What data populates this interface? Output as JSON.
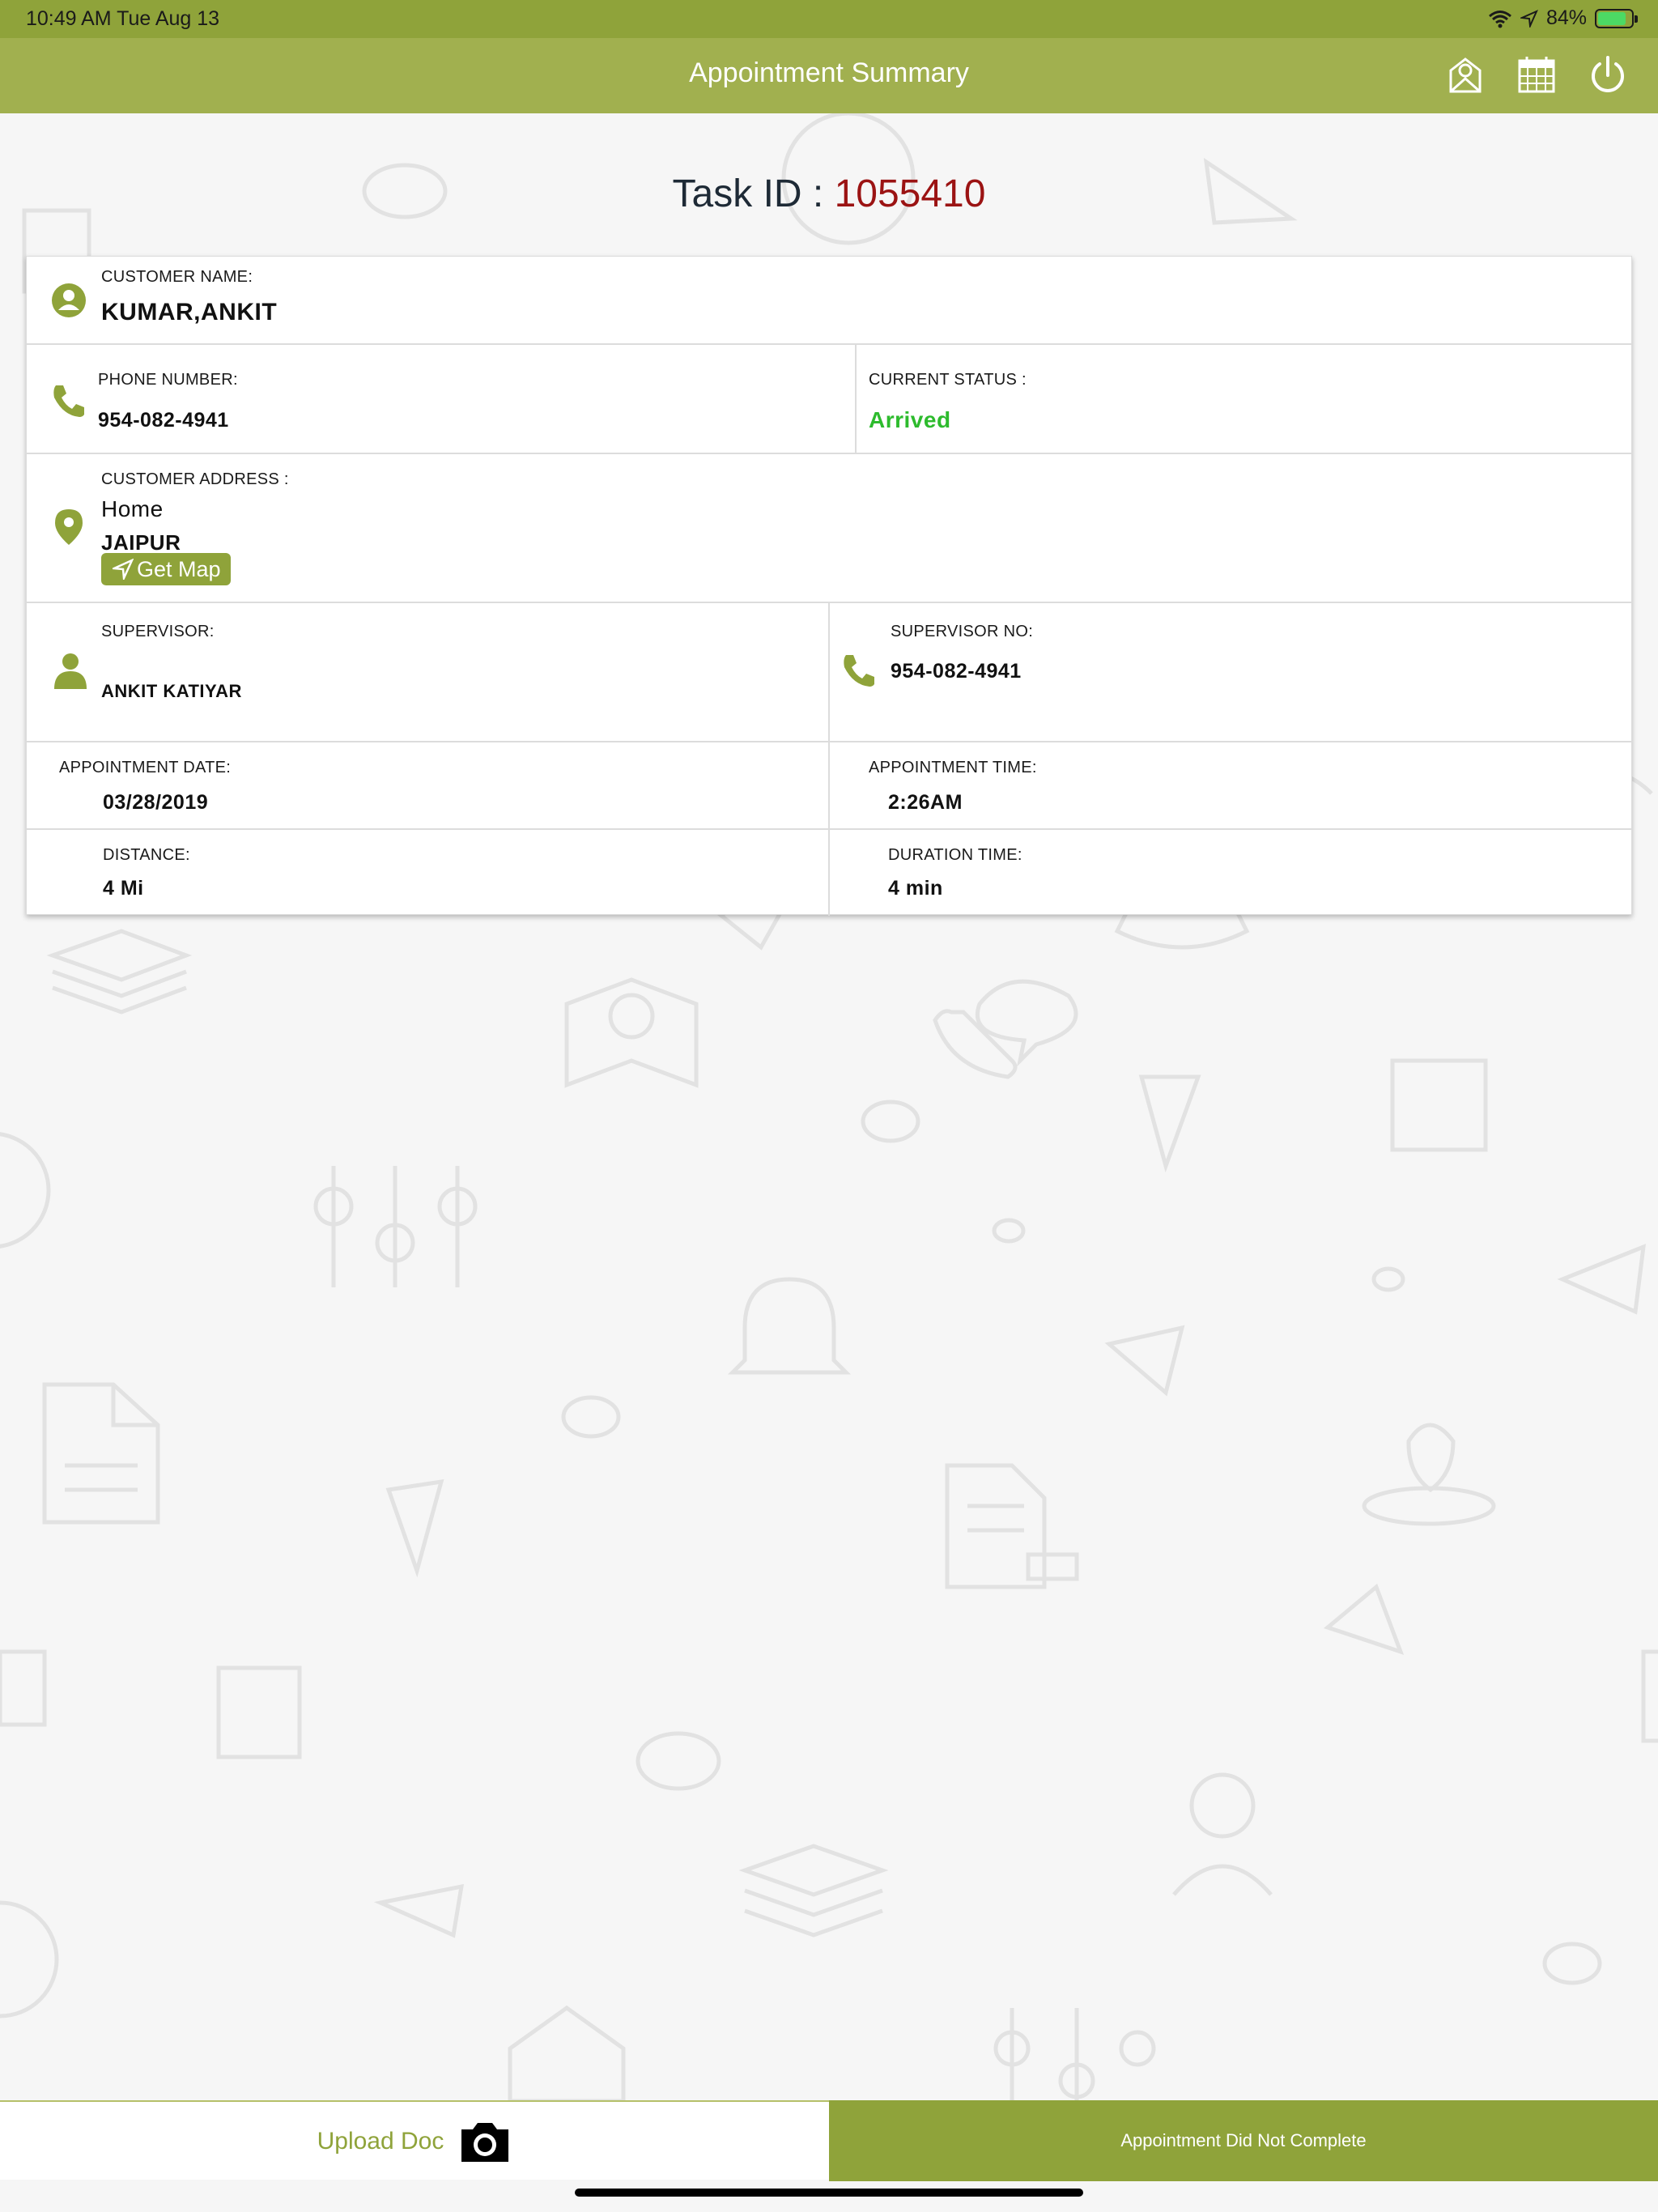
{
  "status_bar": {
    "time": "10:49 AM   Tue Aug 13",
    "battery": "84%",
    "battery_level": 0.84
  },
  "header": {
    "title": "Appointment Summary",
    "icons": [
      "mail-badge-icon",
      "calendar-icon",
      "power-icon"
    ]
  },
  "task": {
    "label": "Task ID :",
    "id": "1055410"
  },
  "customer": {
    "name_label": "CUSTOMER NAME:",
    "name": "KUMAR,ANKIT"
  },
  "phone": {
    "label": "PHONE NUMBER:",
    "value": "954-082-4941"
  },
  "status": {
    "label": "CURRENT STATUS :",
    "value": "Arrived",
    "color": "#2dbb2d"
  },
  "address": {
    "label": "CUSTOMER ADDRESS :",
    "line1": "Home",
    "city": "JAIPUR",
    "map_button": "Get Map"
  },
  "supervisor": {
    "label": "SUPERVISOR:",
    "name": "ANKIT KATIYAR",
    "no_label": "SUPERVISOR NO:",
    "no": "954-082-4941"
  },
  "appointment": {
    "date_label": "APPOINTMENT DATE:",
    "date": "03/28/2019",
    "time_label": "APPOINTMENT TIME:",
    "time": "2:26AM"
  },
  "trip": {
    "distance_label": "DISTANCE:",
    "distance": "4 Mi",
    "duration_label": "DURATION TIME:",
    "duration": "4 min"
  },
  "footer": {
    "upload_label": "Upload Doc",
    "not_complete_label": "Appointment Did Not Complete"
  },
  "colors": {
    "accent": "#8fa33a",
    "header": "#a1b04f",
    "task_id": "#9b1313"
  }
}
